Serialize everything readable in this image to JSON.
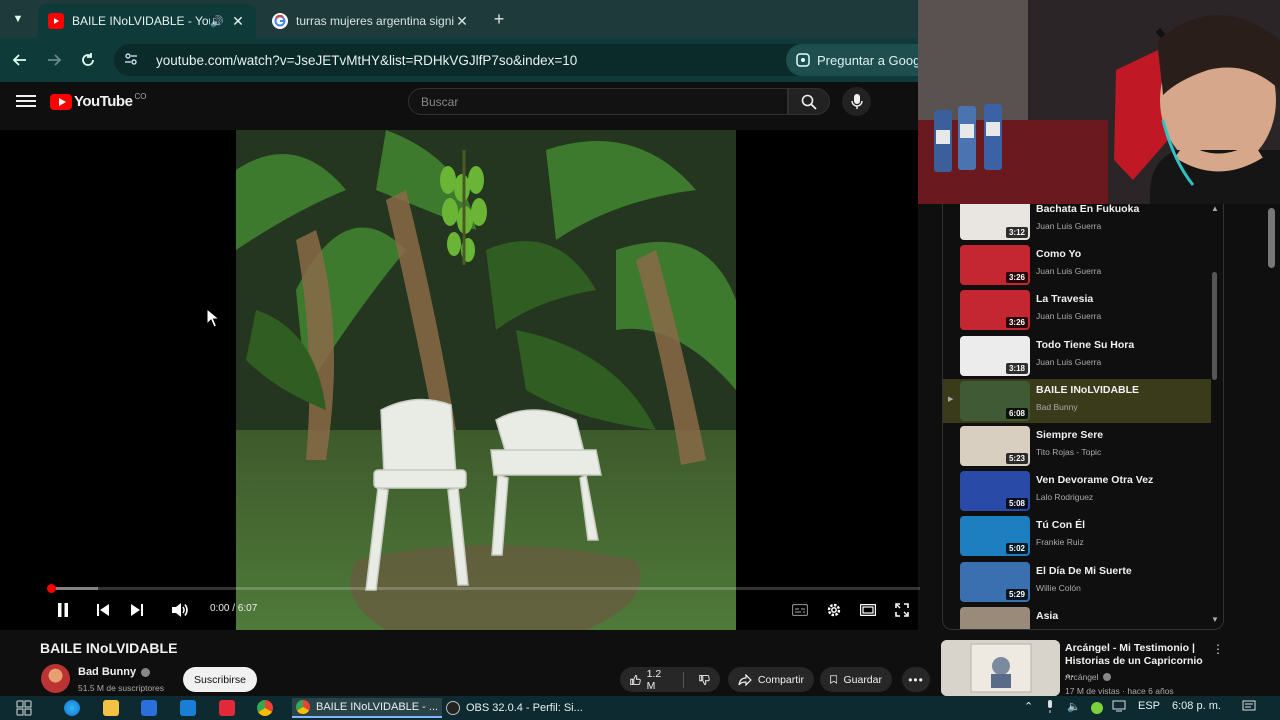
{
  "browser": {
    "tabs": [
      {
        "title": "BAILE INoLVIDABLE - YouTu",
        "active": true
      },
      {
        "title": "turras mujeres argentina signifi",
        "active": false
      }
    ],
    "url": "youtube.com/watch?v=JseJETvMtHY&list=RDHkVGJlfP7so&index=10",
    "ask_button": "Preguntar a Googl"
  },
  "youtube": {
    "logo_text": "YouTube",
    "country_code": "CO",
    "search_placeholder": "Buscar"
  },
  "player": {
    "time": "0:00 / 6:07",
    "progress": 0.0
  },
  "video": {
    "title": "BAILE INoLVIDABLE",
    "channel": "Bad Bunny",
    "subscribers": "51.5 M de suscriptores",
    "subscribe_label": "Suscribirse",
    "likes": "1.2 M",
    "share_label": "Compartir",
    "save_label": "Guardar"
  },
  "playlist": [
    {
      "title": "Bachata En Fukuoka",
      "artist": "Juan Luis Guerra",
      "duration": "3:12",
      "color": "#e9e6e1"
    },
    {
      "title": "Como Yo",
      "artist": "Juan Luis Guerra",
      "duration": "3:26",
      "color": "#c42632"
    },
    {
      "title": "La Travesia",
      "artist": "Juan Luis Guerra",
      "duration": "3:26",
      "color": "#c42632"
    },
    {
      "title": "Todo Tiene Su Hora",
      "artist": "Juan Luis Guerra",
      "duration": "3:18",
      "color": "#ececec"
    },
    {
      "title": "BAILE INoLVIDABLE",
      "artist": "Bad Bunny",
      "duration": "6:08",
      "color": "#3f5a34",
      "current": true
    },
    {
      "title": "Siempre Sere",
      "artist": "Tito Rojas - Topic",
      "duration": "5:23",
      "color": "#d8cfc0"
    },
    {
      "title": "Ven Devorame Otra Vez",
      "artist": "Lalo Rodriguez",
      "duration": "5:08",
      "color": "#2a4aa8"
    },
    {
      "title": "Tú Con Él",
      "artist": "Frankie Ruiz",
      "duration": "5:02",
      "color": "#1d7fc0"
    },
    {
      "title": "El Día De Mi Suerte",
      "artist": "Willie Colón",
      "duration": "5:29",
      "color": "#3a6fb0"
    },
    {
      "title": "Asia",
      "artist": "",
      "duration": "",
      "color": "#9a8a7a"
    }
  ],
  "recommendation": {
    "title": "Arcángel - Mi Testimonio | Historias de un Capricornio ...",
    "channel": "Arcángel",
    "meta": "17 M de vistas · hace 6 años"
  },
  "taskbar": {
    "apps": [
      {
        "label": "BAILE INoLVIDABLE - ..."
      },
      {
        "label": "OBS 32.0.4 - Perfil: Si..."
      }
    ],
    "language": "ESP",
    "clock": "6:08 p. m."
  },
  "colors": {
    "accent": "#ff0000",
    "chrome_bg": "#0f3a3a",
    "current_item_bg": "#3a3b1a"
  }
}
